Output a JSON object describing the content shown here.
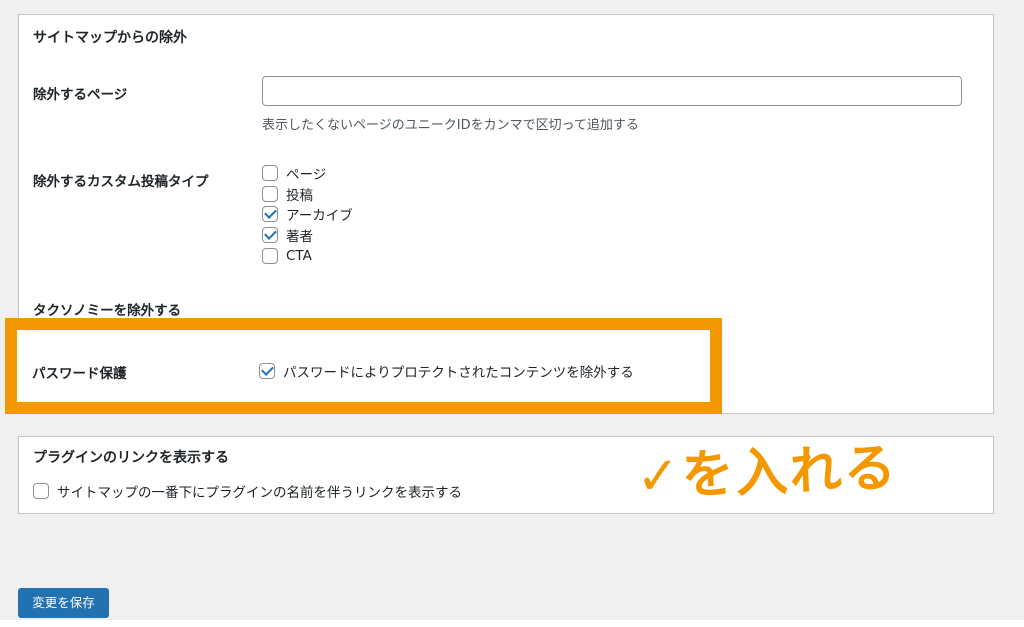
{
  "sitemap_exclusion": {
    "section_title": "サイトマップからの除外",
    "exclude_pages": {
      "label": "除外するページ",
      "value": "",
      "description": "表示したくないページのユニークIDをカンマで区切って追加する"
    },
    "exclude_post_types": {
      "label": "除外するカスタム投稿タイプ",
      "options": [
        {
          "label": "ページ",
          "checked": false
        },
        {
          "label": "投稿",
          "checked": false
        },
        {
          "label": "アーカイブ",
          "checked": true
        },
        {
          "label": "著者",
          "checked": true
        },
        {
          "label": "CTA",
          "checked": false
        }
      ]
    },
    "exclude_taxonomy": {
      "label": "タクソノミーを除外する"
    },
    "password_protection": {
      "label": "パスワード保護",
      "option_label": "パスワードによりプロテクトされたコンテンツを除外する",
      "checked": true
    }
  },
  "plugin_link": {
    "section_title": "プラグインのリンクを表示する",
    "option_label": "サイトマップの一番下にプラグインの名前を伴うリンクを表示する",
    "checked": false
  },
  "save_button_label": "変更を保存",
  "annotation": {
    "text": "✓を入れる",
    "color": "#f39800"
  },
  "colors": {
    "accent": "#2271b1",
    "highlight": "#f39800"
  }
}
